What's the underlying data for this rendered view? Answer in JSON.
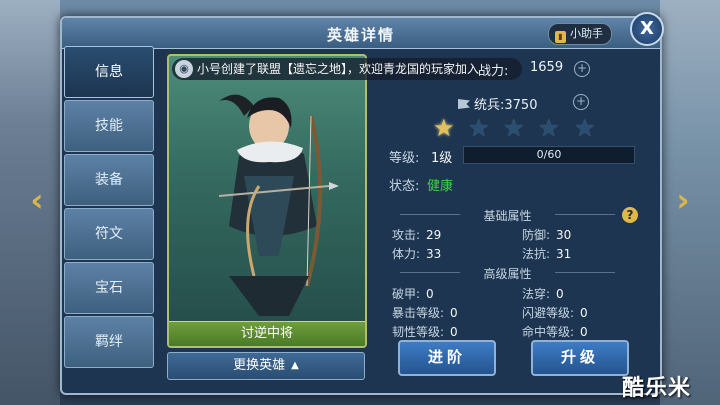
{
  "window": {
    "title": "英雄详情",
    "helper_label": "小助手",
    "close_glyph": "X"
  },
  "tabs": [
    {
      "label": "信息",
      "active": true
    },
    {
      "label": "技能",
      "active": false
    },
    {
      "label": "装备",
      "active": false
    },
    {
      "label": "符文",
      "active": false
    },
    {
      "label": "宝石",
      "active": false
    },
    {
      "label": "羁绊",
      "active": false
    }
  ],
  "nav": {
    "prev_glyph": "‹",
    "next_glyph": "›"
  },
  "notice": {
    "text": "小号创建了联盟【遗忘之地】，欢迎青龙国的玩家加入"
  },
  "hero": {
    "name": "讨逆中将",
    "change_label": "更换英雄",
    "power_label": "战力:",
    "power_value": "1659",
    "command_label": "统兵:",
    "command_value": "3750",
    "stars_total": 5,
    "stars_lit": 1,
    "level_label": "等级:",
    "level_value": "1级",
    "exp_text": "0/60",
    "exp_fraction": 0,
    "state_label": "状态:",
    "state_value": "健康"
  },
  "basic_section": {
    "title": "基础属性"
  },
  "basic_attrs": [
    {
      "label": "攻击:",
      "value": "29"
    },
    {
      "label": "防御:",
      "value": "30"
    },
    {
      "label": "体力:",
      "value": "33"
    },
    {
      "label": "法抗:",
      "value": "31"
    }
  ],
  "advanced_section": {
    "title": "高级属性"
  },
  "advanced_attrs": [
    {
      "label": "破甲:",
      "value": "0"
    },
    {
      "label": "法穿:",
      "value": "0"
    },
    {
      "label": "暴击等级:",
      "value": "0"
    },
    {
      "label": "闪避等级:",
      "value": "0"
    },
    {
      "label": "韧性等级:",
      "value": "0"
    },
    {
      "label": "命中等级:",
      "value": "0"
    }
  ],
  "buttons": {
    "advance": "进阶",
    "upgrade": "升级"
  },
  "watermark": "酷乐米",
  "colors": {
    "accent_gold": "#e3c05a",
    "state_green": "#3fd14a",
    "exp_blue": "#3c7ac0"
  }
}
